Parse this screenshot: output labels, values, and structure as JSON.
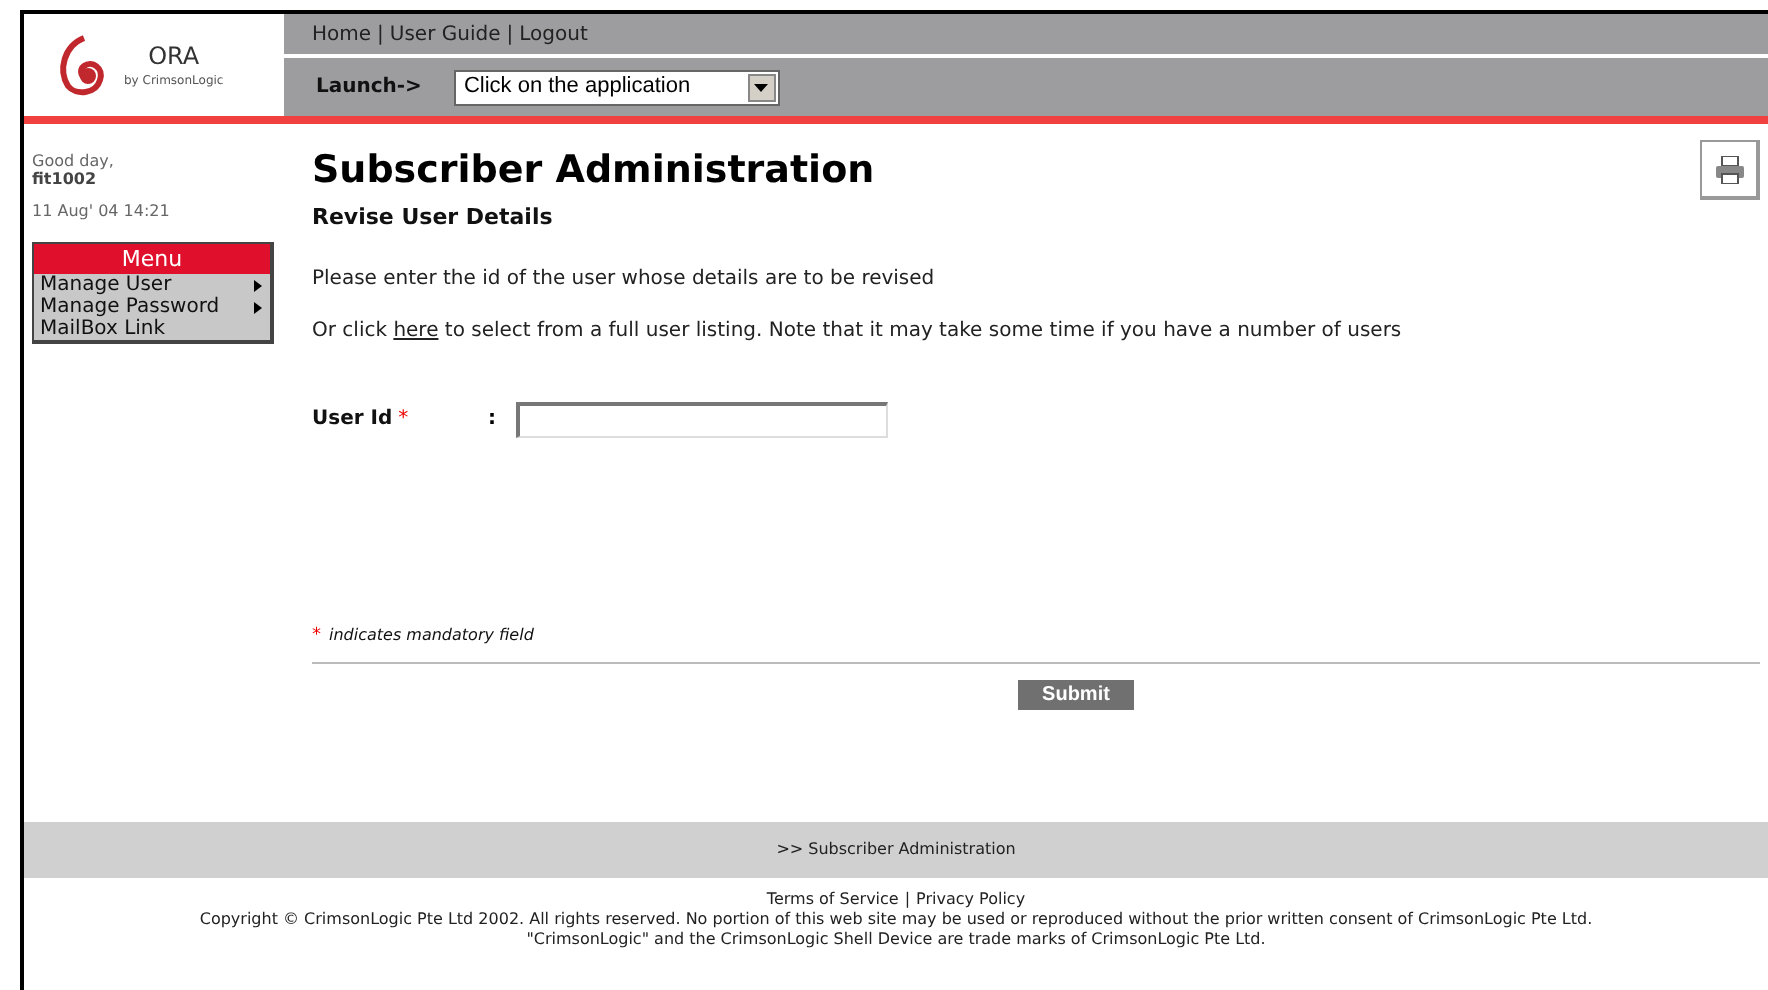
{
  "logo": {
    "name": "ORA",
    "tagline": "by CrimsonLogic"
  },
  "nav": {
    "links": [
      "Home",
      "User Guide",
      "Logout"
    ],
    "separator": "|"
  },
  "launcher": {
    "label": "Launch->",
    "value": "Click on the application"
  },
  "greeting": {
    "text": "Good day,",
    "user": "fit1002",
    "datetime": "11 Aug' 04 14:21"
  },
  "menu": {
    "title": "Menu",
    "items": [
      {
        "label": "Manage User",
        "has_submenu": true
      },
      {
        "label": "Manage Password",
        "has_submenu": true
      },
      {
        "label": "MailBox Link",
        "has_submenu": false
      }
    ]
  },
  "title": "Subscriber Administration",
  "subtitle": "Revise User Details",
  "instruction": "Please enter the id of the user whose details are to be revised",
  "listing_note": {
    "before": "Or click ",
    "link": "here",
    "after": " to select from a full user listing. Note that it may take some time if you have a number of users"
  },
  "fields": [
    {
      "label": "User Id",
      "required": true,
      "colon": ":"
    }
  ],
  "mandatory_note": {
    "mark": "*",
    "text": "indicates mandatory field"
  },
  "submit": "Submit",
  "breadcrumb": ">> Subscriber Administration",
  "footer_links": {
    "links": [
      "Terms of Service",
      "Privacy Policy"
    ],
    "separator": "|"
  },
  "copyright": [
    "Copyright © CrimsonLogic Pte Ltd 2002. All rights reserved. No portion of this web site may be used or reproduced without the prior written consent of CrimsonLogic Pte Ltd.",
    "\"CrimsonLogic\" and the CrimsonLogic Shell Device are trade marks of CrimsonLogic Pte Ltd."
  ]
}
